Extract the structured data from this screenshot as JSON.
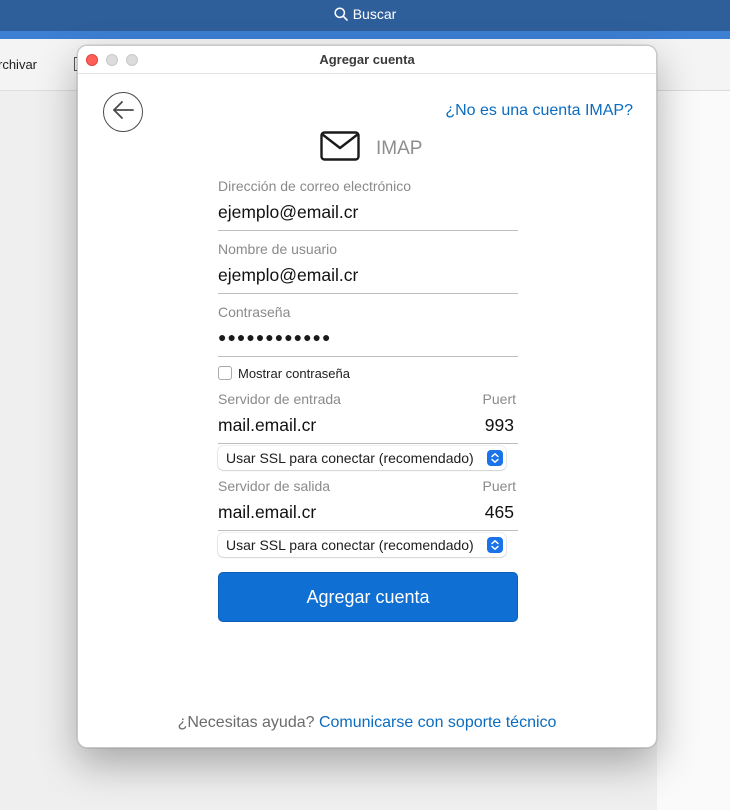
{
  "app": {
    "search_label": "Buscar",
    "ribbon_archive_label": "rchivar"
  },
  "dialog": {
    "title": "Agregar cuenta",
    "not_imap_link": "¿No es una cuenta IMAP?",
    "account_type": "IMAP",
    "email": {
      "label": "Dirección de correo electrónico",
      "value": "ejemplo@email.cr"
    },
    "username": {
      "label": "Nombre de usuario",
      "value": "ejemplo@email.cr"
    },
    "password": {
      "label": "Contraseña",
      "masked_value": "●●●●●●●●●●●●"
    },
    "show_password_label": "Mostrar contraseña",
    "incoming": {
      "label": "Servidor de entrada",
      "value": "mail.email.cr",
      "port_label": "Puert",
      "port_value": "993",
      "ssl_option": "Usar SSL para conectar (recomendado)"
    },
    "outgoing": {
      "label": "Servidor de salida",
      "value": "mail.email.cr",
      "port_label": "Puert",
      "port_value": "465",
      "ssl_option": "Usar SSL para conectar (recomendado)"
    },
    "submit_label": "Agregar cuenta",
    "help_text": "¿Necesitas ayuda?",
    "help_link": "Comunicarse con soporte técnico"
  },
  "colors": {
    "accent": "#0f6fd3",
    "link": "#0b6cbf",
    "app_titlebar": "#2f5f9b",
    "close_button": "#ff5f57"
  },
  "icons": {
    "search": "magnifier-icon",
    "back": "arrow-left-icon",
    "mail": "envelope-icon",
    "stepper": "chevron-updown-icon"
  }
}
